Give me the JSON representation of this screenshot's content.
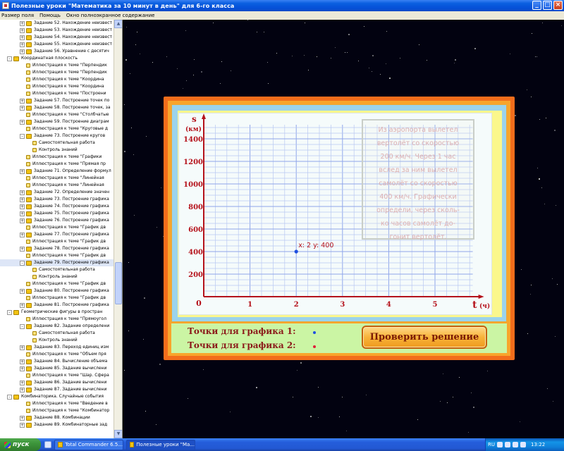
{
  "window": {
    "title": "Полезные уроки \"Математика за 10 минут в день\" для 6-го класса",
    "buttons": [
      "_",
      "□",
      "×"
    ]
  },
  "menu": [
    "Размер поля",
    "Помощь",
    "Окно полноэкранное содержание"
  ],
  "tree": [
    {
      "label": "Задание 52. Нахождение неизвест",
      "exp": "+",
      "icon": "folder"
    },
    {
      "label": "Задание 53. Нахождение неизвест",
      "exp": "+",
      "icon": "folder"
    },
    {
      "label": "Задание 54. Нахождение неизвест",
      "exp": "+",
      "icon": "folder"
    },
    {
      "label": "Задание 55. Нахождение неизвест",
      "exp": "+",
      "icon": "folder"
    },
    {
      "label": "Задание 56. Уравнение с десятич",
      "exp": "+",
      "icon": "folder"
    },
    {
      "label": "Координатная плоскость",
      "exp": "-",
      "icon": "folder",
      "indent": 0
    },
    {
      "label": "Иллюстрация к теме \"Перпендик",
      "icon": "doc"
    },
    {
      "label": "Иллюстрация к теме \"Перпендик",
      "icon": "doc"
    },
    {
      "label": "Иллюстрация к теме \"Координа",
      "icon": "doc"
    },
    {
      "label": "Иллюстрация к теме \"Координа",
      "icon": "doc"
    },
    {
      "label": "Иллюстрация к теме \"Построени",
      "icon": "doc"
    },
    {
      "label": "Задание 57. Построение точек по",
      "exp": "+",
      "icon": "folder"
    },
    {
      "label": "Задание 58. Построение точек, за",
      "exp": "+",
      "icon": "folder"
    },
    {
      "label": "Иллюстрация к теме \"Столбчатые",
      "icon": "doc"
    },
    {
      "label": "Задание 59. Построение диаграм",
      "exp": "+",
      "icon": "folder"
    },
    {
      "label": "Иллюстрация к теме \"Круговые д",
      "icon": "doc"
    },
    {
      "label": "Задание 73. Построение кругов",
      "exp": "-",
      "icon": "folder"
    },
    {
      "label": "Самостоятельная работа",
      "icon": "doc",
      "sub": true
    },
    {
      "label": "Контроль знаний",
      "icon": "doc",
      "sub": true
    },
    {
      "label": "Иллюстрация к теме \"Графики",
      "icon": "doc"
    },
    {
      "label": "Иллюстрация к теме \"Прямая пр",
      "icon": "doc"
    },
    {
      "label": "Задание 71. Определение формул",
      "exp": "+",
      "icon": "folder"
    },
    {
      "label": "Иллюстрация к теме \"Линейная",
      "icon": "doc"
    },
    {
      "label": "Иллюстрация к теме \"Линейная",
      "icon": "doc"
    },
    {
      "label": "Задание 72. Определение значен",
      "exp": "+",
      "icon": "folder"
    },
    {
      "label": "Задание 73. Построение графика",
      "exp": "+",
      "icon": "folder"
    },
    {
      "label": "Задание 74. Построение графика",
      "exp": "+",
      "icon": "folder"
    },
    {
      "label": "Задание 75. Построение графика",
      "exp": "+",
      "icon": "folder"
    },
    {
      "label": "Задание 76. Построение графика",
      "exp": "+",
      "icon": "folder"
    },
    {
      "label": "Иллюстрация к теме \"График дв",
      "icon": "doc"
    },
    {
      "label": "Задание 77. Построение графика",
      "exp": "+",
      "icon": "folder"
    },
    {
      "label": "Иллюстрация к теме \"График дв",
      "icon": "doc"
    },
    {
      "label": "Задание 78. Построение графика",
      "exp": "+",
      "icon": "folder"
    },
    {
      "label": "Иллюстрация к теме \"График дв",
      "icon": "doc"
    },
    {
      "label": "Задание 79. Построение графика",
      "exp": "-",
      "icon": "folder",
      "selected": true
    },
    {
      "label": "Самостоятельная работа",
      "icon": "doc",
      "sub": true
    },
    {
      "label": "Контроль знаний",
      "icon": "doc",
      "sub": true
    },
    {
      "label": "Иллюстрация к теме \"График дв",
      "icon": "doc"
    },
    {
      "label": "Задание 80. Построение графика",
      "exp": "+",
      "icon": "folder"
    },
    {
      "label": "Иллюстрация к теме \"График дв",
      "icon": "doc"
    },
    {
      "label": "Задание 81. Построение графика",
      "exp": "+",
      "icon": "folder"
    },
    {
      "label": "Геометрические фигуры в простран",
      "exp": "-",
      "icon": "folder",
      "indent": 0
    },
    {
      "label": "Иллюстрация к теме \"Прямоугол",
      "icon": "doc"
    },
    {
      "label": "Задание 82. Задание определени",
      "exp": "-",
      "icon": "folder"
    },
    {
      "label": "Самостоятельная работа",
      "icon": "doc",
      "sub": true
    },
    {
      "label": "Контроль знаний",
      "icon": "doc",
      "sub": true
    },
    {
      "label": "Задание 83. Переход единиц изм",
      "exp": "+",
      "icon": "folder"
    },
    {
      "label": "Иллюстрация к теме \"Объем пря",
      "icon": "doc"
    },
    {
      "label": "Задание 84. Вычисление объема",
      "exp": "+",
      "icon": "folder"
    },
    {
      "label": "Задание 85. Задание вычислени",
      "exp": "+",
      "icon": "folder"
    },
    {
      "label": "Иллюстрация к теме \"Шар. Сфера",
      "icon": "doc"
    },
    {
      "label": "Задание 86. Задание вычислени",
      "exp": "+",
      "icon": "folder"
    },
    {
      "label": "Задание 87. Задание вычислени",
      "exp": "+",
      "icon": "folder"
    },
    {
      "label": "Комбинаторика. Случайные события",
      "exp": "-",
      "icon": "folder",
      "indent": 0
    },
    {
      "label": "Иллюстрация к теме \"Введение в",
      "icon": "doc"
    },
    {
      "label": "Иллюстрация к теме \"Комбинатор",
      "icon": "doc"
    },
    {
      "label": "Задание 88. Комбинации",
      "exp": "+",
      "icon": "folder"
    },
    {
      "label": "Задание 89. Комбинаторные зад",
      "exp": "+",
      "icon": "folder"
    }
  ],
  "task": {
    "text_lines": [
      "Из аэропорта вылетел",
      "вертолёт со скоростью",
      "200 км/ч. Через 1 час",
      "вслед за ним вылетел",
      "самолёт со скоростью",
      "400 км/ч. Графически",
      "определи, через сколь-",
      "ко часов самолёт до-",
      "гонит вертолёт."
    ]
  },
  "chart_data": {
    "type": "scatter",
    "x_axis_label": "t",
    "x_unit": "(ч)",
    "y_axis_label": "s",
    "y_unit": "(км)",
    "x_ticks": [
      0,
      1,
      2,
      3,
      4,
      5
    ],
    "y_ticks": [
      200,
      400,
      600,
      800,
      1000,
      1200,
      1400
    ],
    "origin_label": "0",
    "xlim": [
      0,
      6
    ],
    "ylim": [
      0,
      1600
    ],
    "grid": true,
    "points": [
      {
        "x": 2,
        "y": 400,
        "color": "#1f4fe0",
        "label": "x: 2  y: 400"
      }
    ]
  },
  "legend": {
    "series1": {
      "label": "Точки для графика 1:",
      "color": "#1f4fe0"
    },
    "series2": {
      "label": "Точки для графика 2:",
      "color": "#e0203a"
    }
  },
  "check_button": "Проверить решение",
  "taskbar": {
    "start": "пуск",
    "tasks": [
      "Total Commander 6.5...",
      "Полезные уроки \"Ма..."
    ],
    "tray_lang": "RU",
    "clock": "13:22"
  }
}
